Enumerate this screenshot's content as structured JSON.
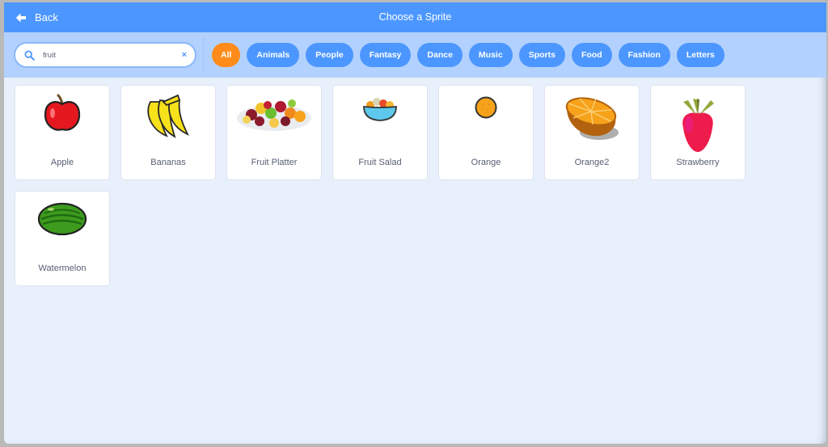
{
  "header": {
    "back_label": "Back",
    "back_icon": "arrow-left-icon",
    "title": "Choose a Sprite"
  },
  "search": {
    "value": "fruit",
    "icon": "search-icon",
    "clear_label": "×"
  },
  "tags": [
    {
      "label": "All",
      "active": true
    },
    {
      "label": "Animals",
      "active": false
    },
    {
      "label": "People",
      "active": false
    },
    {
      "label": "Fantasy",
      "active": false
    },
    {
      "label": "Dance",
      "active": false
    },
    {
      "label": "Music",
      "active": false
    },
    {
      "label": "Sports",
      "active": false
    },
    {
      "label": "Food",
      "active": false
    },
    {
      "label": "Fashion",
      "active": false
    },
    {
      "label": "Letters",
      "active": false
    }
  ],
  "sprites": [
    {
      "name": "Apple",
      "icon": "apple-icon"
    },
    {
      "name": "Bananas",
      "icon": "bananas-icon"
    },
    {
      "name": "Fruit Platter",
      "icon": "fruit-platter-icon"
    },
    {
      "name": "Fruit Salad",
      "icon": "fruit-salad-icon"
    },
    {
      "name": "Orange",
      "icon": "orange-icon"
    },
    {
      "name": "Orange2",
      "icon": "orange-half-icon"
    },
    {
      "name": "Strawberry",
      "icon": "strawberry-icon"
    },
    {
      "name": "Watermelon",
      "icon": "watermelon-icon"
    }
  ],
  "colors": {
    "header": "#4c97ff",
    "filterbar": "#b3d1fe",
    "active_tag": "#ff8c1a",
    "tag": "#4c97ff",
    "background": "#e8f0fc"
  }
}
